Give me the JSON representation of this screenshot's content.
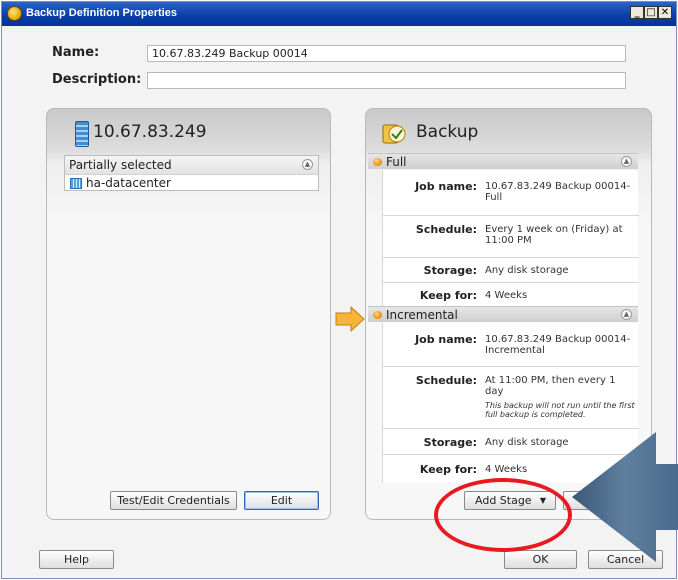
{
  "window": {
    "title": "Backup Definition Properties",
    "minimize": "_",
    "maximize": "□",
    "close": "✕"
  },
  "form": {
    "name_label": "Name:",
    "name_value": "10.67.83.249 Backup 00014",
    "description_label": "Description:",
    "description_value": ""
  },
  "source_panel": {
    "title": "10.67.83.249",
    "list_header": "Partially selected",
    "items": [
      "ha-datacenter"
    ],
    "test_button": "Test/Edit Credentials",
    "edit_button": "Edit"
  },
  "backup_panel": {
    "title": "Backup",
    "stages": [
      {
        "name": "Full",
        "job_name_label": "Job name:",
        "job_name": "10.67.83.249 Backup 00014-Full",
        "schedule_label": "Schedule:",
        "schedule": "Every 1 week on (Friday) at 11:00 PM",
        "storage_label": "Storage:",
        "storage": "Any disk storage",
        "keep_label": "Keep for:",
        "keep": "4 Weeks"
      },
      {
        "name": "Incremental",
        "job_name_label": "Job name:",
        "job_name": "10.67.83.249 Backup 00014-Incremental",
        "schedule_label": "Schedule:",
        "schedule": "At 11:00 PM, then every 1 day",
        "schedule_note": "This backup will not run until the first full backup is completed.",
        "storage_label": "Storage:",
        "storage": "Any disk storage",
        "keep_label": "Keep for:",
        "keep": "4 Weeks"
      }
    ],
    "add_stage_button": "Add Stage",
    "edit_button": "E"
  },
  "footer": {
    "help": "Help",
    "ok": "OK",
    "cancel": "Cancel"
  },
  "colors": {
    "titlebar": "#0a3fa8",
    "annotation_red": "#e8191f",
    "annotation_arrow": "#4e6d8c",
    "flow_arrow": "#f5b43a"
  }
}
